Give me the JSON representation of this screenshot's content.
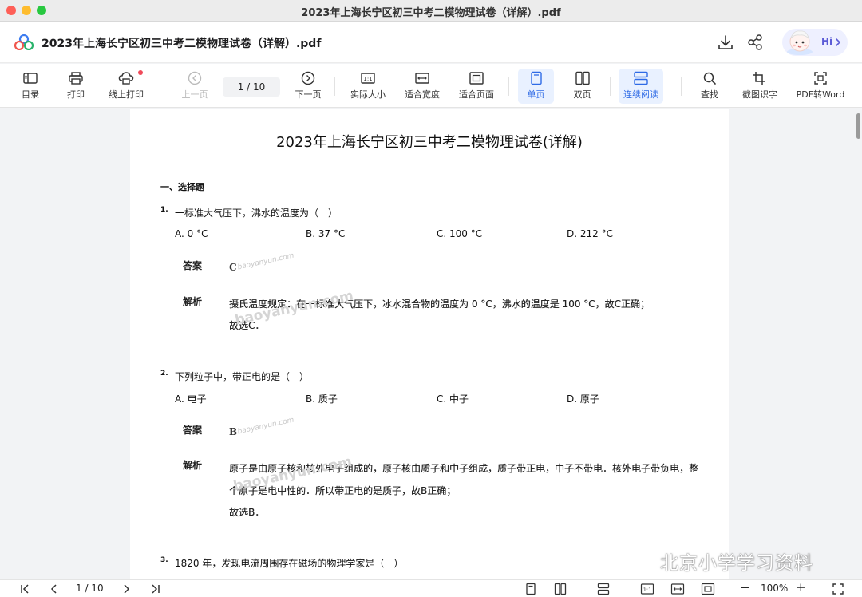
{
  "window": {
    "title": "2023年上海长宁区初三中考二模物理试卷（详解）.pdf"
  },
  "header": {
    "doc_title": "2023年上海长宁区初三中考二模物理试卷（详解）.pdf",
    "hi_label": "Hi",
    "icons": [
      "app-logo-icon",
      "download-icon",
      "share-icon",
      "assistant-avatar-icon",
      "chevron-right-icon"
    ]
  },
  "toolbar": {
    "toc": "目录",
    "print": "打印",
    "online_print": "线上打印",
    "prev_page": "上一页",
    "page_indicator": "1  /  10",
    "next_page": "下一页",
    "actual_size": "实际大小",
    "fit_width": "适合宽度",
    "fit_page": "适合页面",
    "single_page": "单页",
    "double_page": "双页",
    "continuous": "连续阅读",
    "find": "查找",
    "ocr": "截图识字",
    "pdf_to_word": "PDF转Word",
    "accent_color": "#2f6be6",
    "active_bg": "#e9f1ff"
  },
  "document": {
    "title": "2023年上海长宁区初三中考二模物理试卷(详解)",
    "section": "一、选择题",
    "answer_label": "答案",
    "analysis_label": "解析",
    "watermark": "baoyanyun.com",
    "questions": [
      {
        "num": "1.",
        "text": "一标准大气压下，沸水的温度为（　）",
        "options": [
          "A. 0 °C",
          "B. 37 °C",
          "C. 100 °C",
          "D. 212 °C"
        ],
        "answer": "C",
        "analysis": [
          "摄氏温度规定：在一标准大气压下，冰水混合物的温度为  0 °C，沸水的温度是 100 °C，故C正确；",
          "故选C．"
        ]
      },
      {
        "num": "2.",
        "text": "下列粒子中，带正电的是（　）",
        "options": [
          "A. 电子",
          "B. 质子",
          "C. 中子",
          "D. 原子"
        ],
        "answer": "B",
        "analysis": [
          "原子是由原子核和核外电子组成的，原子核由质子和中子组成，质子带正电，中子不带电．核外电子带负电，整",
          "个原子是电中性的．所以带正电的是质子，故B正确；",
          "故选B．"
        ]
      },
      {
        "num": "3.",
        "text": "1820 年，发现电流周围存在磁场的物理学家是（　）"
      }
    ]
  },
  "bottombar": {
    "page_indicator": "1  /  10",
    "zoom": "100%",
    "minus": "−",
    "plus": "+"
  },
  "overlay": {
    "wechat_text": "北京小学学习资料"
  }
}
